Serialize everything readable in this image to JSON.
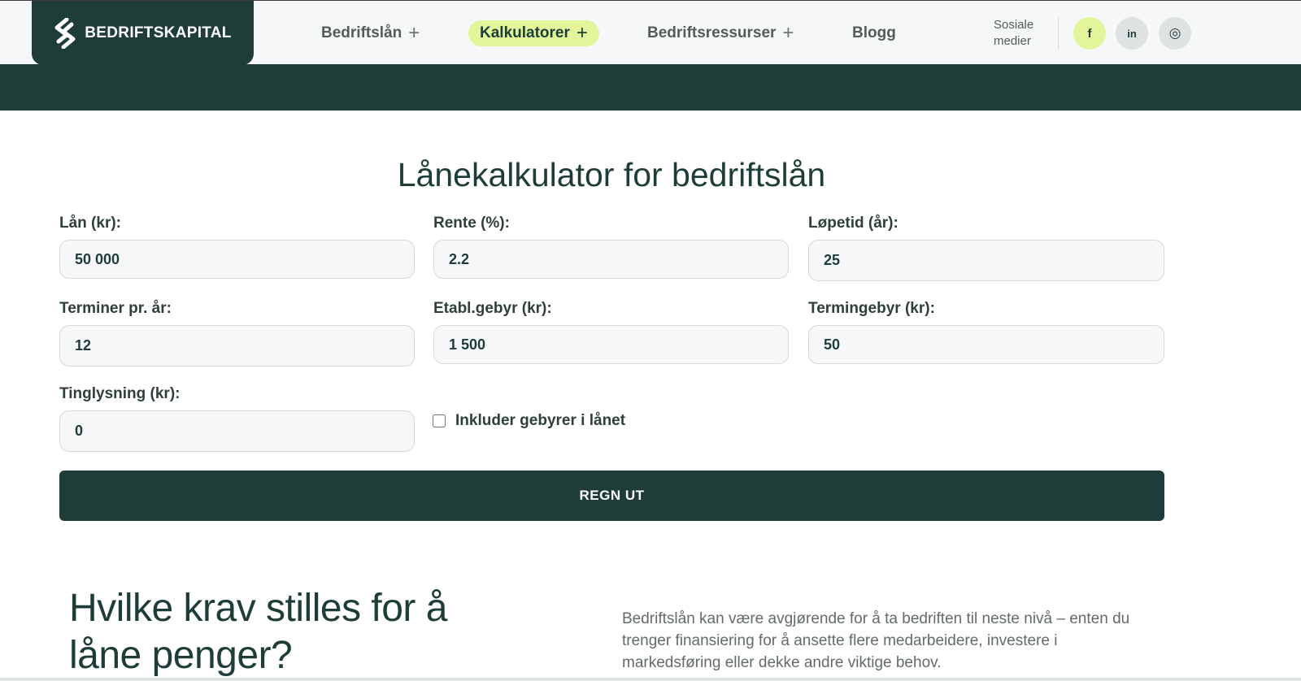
{
  "header": {
    "logo_text": "BEDRIFTSKAPITAL",
    "nav": [
      {
        "label": "Bedriftslån",
        "has_plus": true,
        "active": false
      },
      {
        "label": "Kalkulatorer",
        "has_plus": true,
        "active": true
      },
      {
        "label": "Bedriftsressurser",
        "has_plus": true,
        "active": false
      },
      {
        "label": "Blogg",
        "has_plus": false,
        "active": false
      }
    ],
    "plus_symbol": "+",
    "social_label": "Sosiale medier",
    "social": [
      {
        "icon": "facebook-icon",
        "glyph": "f",
        "color": "#e2f59b"
      },
      {
        "icon": "linkedin-icon",
        "glyph": "in",
        "color": "#dfe2e2"
      },
      {
        "icon": "instagram-icon",
        "glyph": "◎",
        "color": "#dfe2e2"
      }
    ]
  },
  "calculator": {
    "title": "Lånekalkulator for bedriftslån",
    "fields": {
      "loan": {
        "label": "Lån (kr):",
        "value": "50 000"
      },
      "rate": {
        "label": "Rente (%):",
        "value": "2.2"
      },
      "term": {
        "label": "Løpetid (år):",
        "value": "25"
      },
      "terms_per_year": {
        "label": "Terminer pr. år:",
        "value": "12"
      },
      "setup_fee": {
        "label": "Etabl.gebyr (kr):",
        "value": "1 500"
      },
      "term_fee": {
        "label": "Termingebyr (kr):",
        "value": "50"
      },
      "registration": {
        "label": "Tinglysning (kr):",
        "value": "0"
      }
    },
    "include_fees_label": "Inkluder gebyrer i lånet",
    "include_fees_checked": false,
    "submit_label": "REGN UT"
  },
  "section": {
    "heading": "Hvilke krav stilles for å låne penger?",
    "text": "Bedriftslån kan være avgjørende for å ta bedriften til neste nivå – enten du trenger finansiering for å ansette flere medarbeidere, investere i markedsføring eller dekke andre viktige behov."
  },
  "colors": {
    "brand_dark": "#1e3d38",
    "accent": "#e2f59b",
    "topbar_bg": "#f5f7f8"
  }
}
